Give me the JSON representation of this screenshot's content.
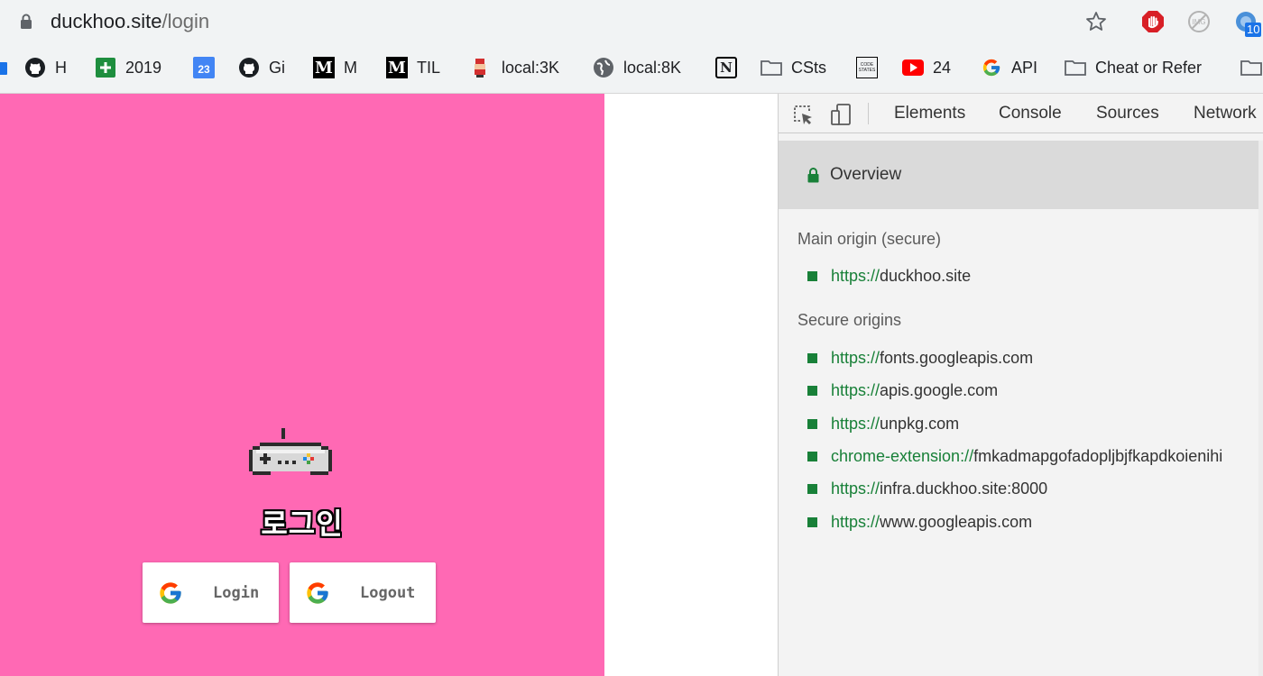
{
  "browser": {
    "url_host": "duckhoo.site",
    "url_path": "/login",
    "extension_badge": "10",
    "bookmarks": [
      {
        "label": "H",
        "icon": "github-icon"
      },
      {
        "label": "2019",
        "icon": "google-sheets-icon"
      },
      {
        "label": "",
        "icon": "google-calendar-icon",
        "icon_text": "23"
      },
      {
        "label": "Gi",
        "icon": "github-icon"
      },
      {
        "label": "M",
        "icon": "medium-icon"
      },
      {
        "label": "TIL",
        "icon": "medium-icon"
      },
      {
        "label": "local:3K",
        "icon": "pixel-character-icon"
      },
      {
        "label": "local:8K",
        "icon": "globe-icon"
      },
      {
        "label": "",
        "icon": "notion-icon"
      },
      {
        "label": "CSts",
        "icon": "folder-icon"
      },
      {
        "label": "",
        "icon": "codestates-icon"
      },
      {
        "label": "24",
        "icon": "youtube-icon"
      },
      {
        "label": "API",
        "icon": "google-icon"
      },
      {
        "label": "Cheat or Refer",
        "icon": "folder-icon"
      },
      {
        "label": "",
        "icon": "folder-icon"
      }
    ]
  },
  "page": {
    "title": "로그인",
    "buttons": [
      {
        "label": "Login",
        "icon": "google-g-icon"
      },
      {
        "label": "Logout",
        "icon": "google-g-icon"
      }
    ],
    "background_color": "#ff69b4"
  },
  "devtools": {
    "tabs": [
      "Elements",
      "Console",
      "Sources",
      "Network"
    ],
    "overview_label": "Overview",
    "main_origin_heading": "Main origin (secure)",
    "main_origin": {
      "scheme": "https://",
      "host": "duckhoo.site"
    },
    "secure_origins_heading": "Secure origins",
    "secure_origins": [
      {
        "scheme": "https://",
        "host": "fonts.googleapis.com"
      },
      {
        "scheme": "https://",
        "host": "apis.google.com"
      },
      {
        "scheme": "https://",
        "host": "unpkg.com"
      },
      {
        "scheme": "chrome-extension://",
        "host": "fmkadmapgofadopljbjfkapdkoienihi"
      },
      {
        "scheme": "https://",
        "host": "infra.duckhoo.site:8000"
      },
      {
        "scheme": "https://",
        "host": "www.googleapis.com"
      }
    ],
    "secure_color": "#188038"
  }
}
